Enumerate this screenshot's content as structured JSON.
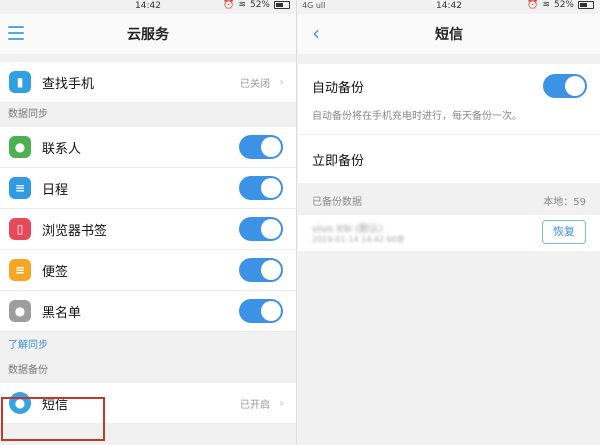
{
  "status_left": {
    "time": "14:42",
    "battery": "52%",
    "alarm_icon": "alarm-icon",
    "wifi_icon": "wifi-icon"
  },
  "status_right": {
    "carrier": "4G ull",
    "time": "14:42",
    "battery": "52%"
  },
  "left": {
    "title": "云服务",
    "find_phone": {
      "label": "查找手机",
      "state": "已关闭"
    },
    "sync_header": "数据同步",
    "sync_items": [
      {
        "label": "联系人",
        "icon": "contacts-icon",
        "color": "#4caf50",
        "enabled": true
      },
      {
        "label": "日程",
        "icon": "calendar-icon",
        "color": "#2e9be3",
        "enabled": true
      },
      {
        "label": "浏览器书签",
        "icon": "bookmark-icon",
        "color": "#e64a5a",
        "enabled": true
      },
      {
        "label": "便签",
        "icon": "note-icon",
        "color": "#f5a623",
        "enabled": true
      },
      {
        "label": "黑名单",
        "icon": "blacklist-icon",
        "color": "#9e9e9e",
        "enabled": true
      }
    ],
    "learn_sync": "了解同步",
    "backup_header": "数据备份",
    "sms": {
      "label": "短信",
      "state": "已开启"
    }
  },
  "right": {
    "title": "短信",
    "auto_backup": {
      "label": "自动备份",
      "enabled": true,
      "desc": "自动备份将在手机充电时进行，每天备份一次。"
    },
    "backup_now": "立即备份",
    "backed_up": {
      "header": "已备份数据",
      "local_count": "本地：59"
    },
    "backup_entry": {
      "name": "vivo X9i (默认)",
      "date": "2019-01-14 14:42 60条",
      "restore_label": "恢复"
    }
  }
}
